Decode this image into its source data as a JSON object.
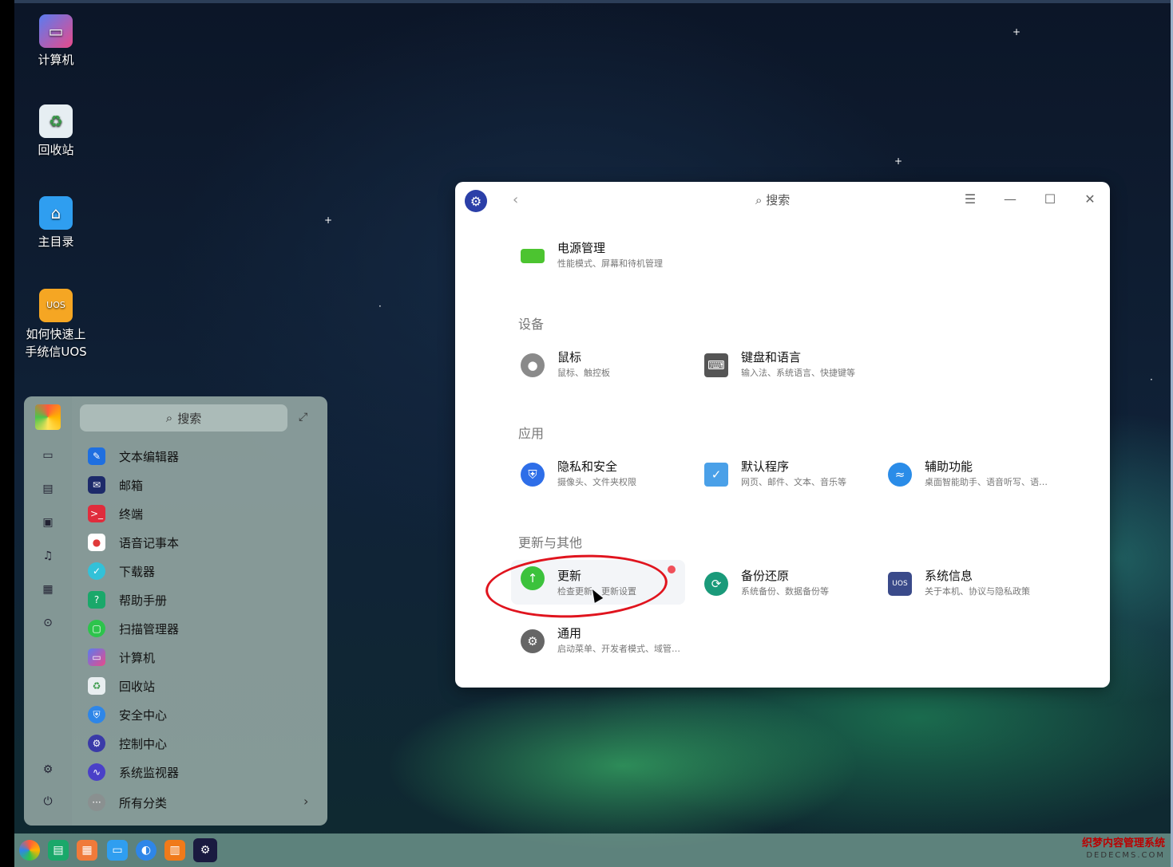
{
  "desktop": {
    "icons": [
      {
        "label": "计算机",
        "icon": "monitor-icon"
      },
      {
        "label": "回收站",
        "icon": "trash-icon"
      },
      {
        "label": "主目录",
        "icon": "home-folder-icon"
      },
      {
        "label": "如何快速上手统信UOS",
        "icon": "uos-guide-icon"
      }
    ]
  },
  "launcher": {
    "search_placeholder": "搜索",
    "apps": [
      {
        "label": "文本编辑器",
        "color": "#1f6fe0"
      },
      {
        "label": "邮箱",
        "color": "#1d2a6a"
      },
      {
        "label": "终端",
        "color": "#e02c3c"
      },
      {
        "label": "语音记事本",
        "color": "#ffffff"
      },
      {
        "label": "下载器",
        "color": "#33c1d8"
      },
      {
        "label": "帮助手册",
        "color": "#1aa86a"
      },
      {
        "label": "扫描管理器",
        "color": "#2dc44c"
      },
      {
        "label": "计算机",
        "color": "#5a54d8"
      },
      {
        "label": "回收站",
        "color": "#e8eef0"
      },
      {
        "label": "安全中心",
        "color": "#2e86e8"
      },
      {
        "label": "控制中心",
        "color": "#3a3aa8"
      },
      {
        "label": "系统监视器",
        "color": "#4a40c8"
      },
      {
        "label": "所有分类",
        "color": "#8a9090"
      }
    ]
  },
  "window": {
    "search_label": "搜索",
    "top_item": {
      "title": "电源管理",
      "desc": "性能模式、屏幕和待机管理"
    },
    "sections": [
      {
        "title": "设备",
        "items": [
          {
            "title": "鼠标",
            "desc": "鼠标、触控板"
          },
          {
            "title": "键盘和语言",
            "desc": "输入法、系统语言、快捷键等"
          }
        ]
      },
      {
        "title": "应用",
        "items": [
          {
            "title": "隐私和安全",
            "desc": "摄像头、文件夹权限"
          },
          {
            "title": "默认程序",
            "desc": "网页、邮件、文本、音乐等"
          },
          {
            "title": "辅助功能",
            "desc": "桌面智能助手、语音听写、语…"
          }
        ]
      },
      {
        "title": "更新与其他",
        "items": [
          {
            "title": "更新",
            "desc": "检查更新、更新设置"
          },
          {
            "title": "备份还原",
            "desc": "系统备份、数据备份等"
          },
          {
            "title": "系统信息",
            "desc": "关于本机、协议与隐私政策"
          },
          {
            "title": "通用",
            "desc": "启动菜单、开发者模式、域管…"
          }
        ]
      }
    ]
  },
  "watermark": {
    "line1": "织梦内容管理系统",
    "line2": "DEDECMS.COM"
  }
}
